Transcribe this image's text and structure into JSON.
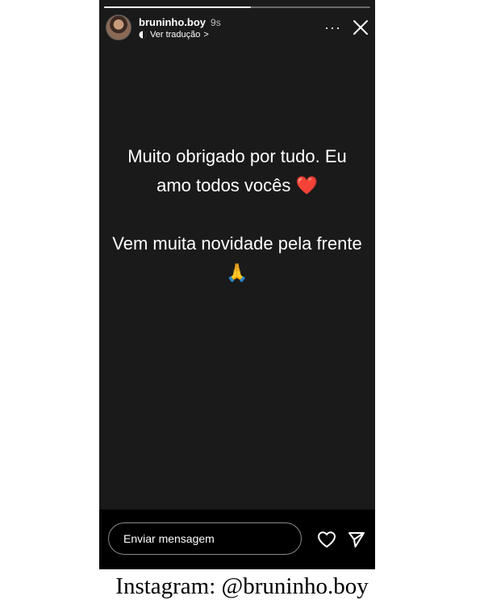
{
  "story": {
    "progress": 0.55,
    "header": {
      "username": "bruninho.boy",
      "time": "9s",
      "translate_label": "Ver tradução",
      "chevron": ">",
      "more_label": "···"
    },
    "text": {
      "line1": "Muito obrigado por tudo. Eu",
      "line2": "amo todos vocês ❤️",
      "line3": "Vem muita novidade pela frente",
      "line4": "🙏"
    },
    "footer": {
      "message_placeholder": "Enviar mensagem"
    }
  },
  "caption": "Instagram: @bruninho.boy",
  "colors": {
    "story_background": "#1a1a1a",
    "footer_background": "#000000",
    "text": "#ffffff",
    "heart": "#e0242c"
  },
  "icons": [
    "translate-icon",
    "more-icon",
    "close-icon",
    "heart-icon",
    "send-icon"
  ]
}
